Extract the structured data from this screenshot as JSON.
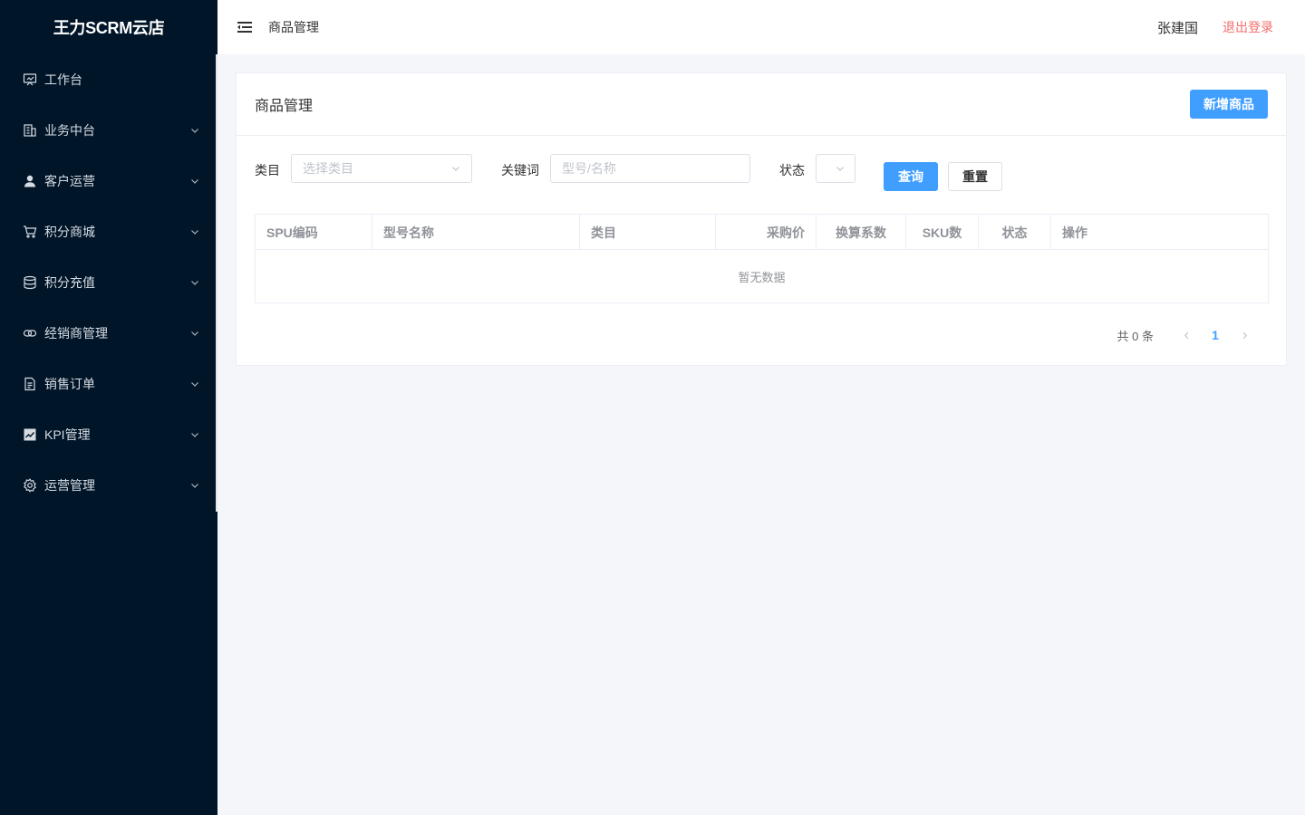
{
  "app": {
    "title": "王力SCRM云店"
  },
  "sidebar": {
    "items": [
      {
        "label": "工作台",
        "icon": "presentation-board-icon",
        "has_submenu": false
      },
      {
        "label": "业务中台",
        "icon": "building-icon",
        "has_submenu": true
      },
      {
        "label": "客户运营",
        "icon": "user-icon",
        "has_submenu": true
      },
      {
        "label": "积分商城",
        "icon": "cart-icon",
        "has_submenu": true
      },
      {
        "label": "积分充值",
        "icon": "database-icon",
        "has_submenu": true
      },
      {
        "label": "经销商管理",
        "icon": "link-icon",
        "has_submenu": true
      },
      {
        "label": "销售订单",
        "icon": "document-icon",
        "has_submenu": true
      },
      {
        "label": "KPI管理",
        "icon": "chart-icon",
        "has_submenu": true
      },
      {
        "label": "运营管理",
        "icon": "gear-icon",
        "has_submenu": true
      }
    ]
  },
  "header": {
    "breadcrumb": "商品管理",
    "username": "张建国",
    "logout_label": "退出登录"
  },
  "card": {
    "title": "商品管理",
    "add_button_label": "新增商品"
  },
  "filters": {
    "category_label": "类目",
    "category_placeholder": "选择类目",
    "keyword_label": "关键词",
    "keyword_placeholder": "型号/名称",
    "status_label": "状态",
    "status_value": "",
    "query_label": "查询",
    "reset_label": "重置"
  },
  "table": {
    "columns": [
      "SPU编码",
      "型号名称",
      "类目",
      "采购价",
      "换算系数",
      "SKU数",
      "状态",
      "操作"
    ],
    "rows": [],
    "empty_text": "暂无数据"
  },
  "pagination": {
    "total_text": "共 0 条",
    "current_page": "1"
  },
  "colors": {
    "sidebar_bg": "#001528",
    "primary": "#409eff",
    "danger": "#f56c6c",
    "page_bg": "#f5f6fa"
  }
}
